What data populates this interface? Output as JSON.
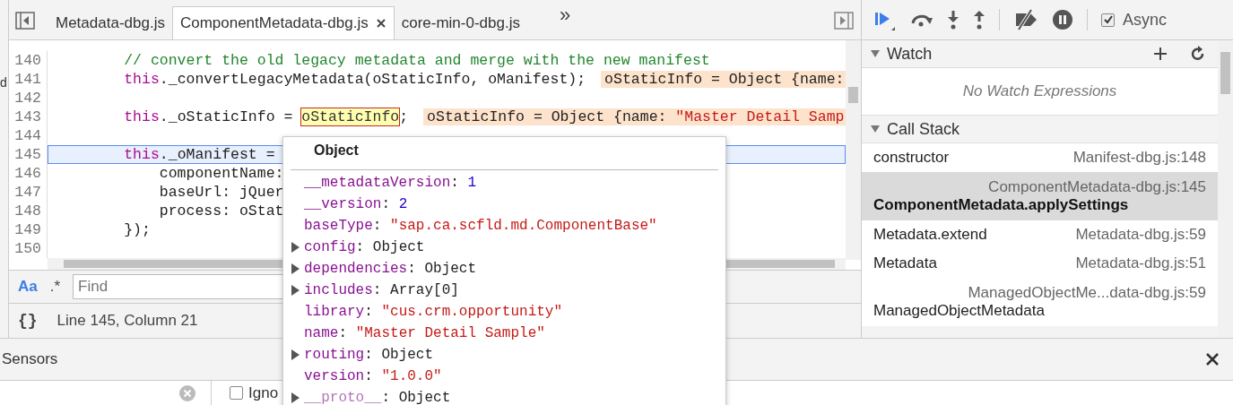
{
  "left_strip": {
    "text": "d"
  },
  "editor_tabs": [
    {
      "label": "Metadata-dbg.js",
      "selected": false
    },
    {
      "label": "ComponentMetadata-dbg.js",
      "selected": true
    },
    {
      "label": "core-min-0-dbg.js",
      "selected": false
    }
  ],
  "more_tabs": "»",
  "code": {
    "lines": [
      {
        "number": "140",
        "current": false,
        "segments": [
          {
            "kind": "comment",
            "text": "        // convert the old legacy metadata and merge with the new manifest"
          }
        ]
      },
      {
        "number": "141",
        "current": false,
        "segments": [
          {
            "kind": "keyword",
            "text": "        this"
          },
          {
            "kind": "plain",
            "text": "._convertLegacyMetadata(oStaticInfo, oManifest);"
          }
        ],
        "inline_value": [
          {
            "kind": "plain",
            "text": "oStaticInfo = Object {name:"
          }
        ]
      },
      {
        "number": "142",
        "current": false
      },
      {
        "number": "143",
        "current": false,
        "segments": [
          {
            "kind": "keyword",
            "text": "        this"
          },
          {
            "kind": "plain",
            "text": "._oStaticInfo = "
          },
          {
            "kind": "hover",
            "text": "oStaticInfo"
          },
          {
            "kind": "plain",
            "text": ";"
          }
        ],
        "inline_value": [
          {
            "kind": "plain",
            "text": "oStaticInfo = Object {name: "
          },
          {
            "kind": "string",
            "text": "\"Master Detail Samp"
          }
        ]
      },
      {
        "number": "144",
        "current": false
      },
      {
        "number": "145",
        "current": true,
        "segments": [
          {
            "kind": "keyword",
            "text": "        this"
          },
          {
            "kind": "plain",
            "text": "._oManifest ="
          }
        ]
      },
      {
        "number": "146",
        "current": false,
        "segments": [
          {
            "kind": "plain",
            "text": "            componentName:"
          }
        ]
      },
      {
        "number": "147",
        "current": false,
        "segments": [
          {
            "kind": "plain",
            "text": "            baseUrl: jQuer"
          }
        ]
      },
      {
        "number": "148",
        "current": false,
        "segments": [
          {
            "kind": "plain",
            "text": "            process: oStat"
          }
        ]
      },
      {
        "number": "149",
        "current": false,
        "segments": [
          {
            "kind": "plain",
            "text": "        });"
          }
        ]
      },
      {
        "number": "150",
        "current": false
      }
    ]
  },
  "popover": {
    "title": "Object",
    "properties": [
      {
        "name": "__metadataVersion",
        "separator": ":",
        "value": "1",
        "kind": "number",
        "expandable": false,
        "internal": false
      },
      {
        "name": "__version",
        "separator": ":",
        "value": "2",
        "kind": "number",
        "expandable": false,
        "internal": false
      },
      {
        "name": "baseType",
        "separator": ":",
        "value": "\"sap.ca.scfld.md.ComponentBase\"",
        "kind": "string",
        "expandable": false,
        "internal": false
      },
      {
        "name": "config",
        "separator": ":",
        "value": "Object",
        "kind": "object",
        "expandable": true,
        "internal": false
      },
      {
        "name": "dependencies",
        "separator": ":",
        "value": "Object",
        "kind": "object",
        "expandable": true,
        "internal": false
      },
      {
        "name": "includes",
        "separator": ":",
        "value": "Array[0]",
        "kind": "object",
        "expandable": true,
        "internal": false
      },
      {
        "name": "library",
        "separator": ":",
        "value": "\"cus.crm.opportunity\"",
        "kind": "string",
        "expandable": false,
        "internal": false
      },
      {
        "name": "name",
        "separator": ":",
        "value": "\"Master Detail Sample\"",
        "kind": "string",
        "expandable": false,
        "internal": false
      },
      {
        "name": "routing",
        "separator": ":",
        "value": "Object",
        "kind": "object",
        "expandable": true,
        "internal": false
      },
      {
        "name": "version",
        "separator": ":",
        "value": "\"1.0.0\"",
        "kind": "string",
        "expandable": false,
        "internal": false
      },
      {
        "name": "__proto__",
        "separator": ":",
        "value": "Object",
        "kind": "object",
        "expandable": true,
        "internal": true
      }
    ]
  },
  "find_bar": {
    "toggles": [
      {
        "label": "Aa",
        "selected": true
      },
      {
        "label": ".*",
        "selected": false
      }
    ],
    "placeholder": "Find"
  },
  "status_bar": {
    "format_button": "{}",
    "position": "Line 145, Column 21"
  },
  "debugger": {
    "async": {
      "label": "Async",
      "checked": true
    },
    "watch": {
      "title": "Watch",
      "expanded": true,
      "empty_text": "No Watch Expressions"
    },
    "call_stack": {
      "title": "Call Stack",
      "expanded": true,
      "frames": [
        {
          "name": "constructor",
          "location": "Manifest-dbg.js:148",
          "selected": false,
          "kind": "inline"
        },
        {
          "name": "ComponentMetadata.applySettings",
          "location": "ComponentMetadata-dbg.js:145",
          "selected": true,
          "kind": "stacked"
        },
        {
          "name": "Metadata.extend",
          "location": "Metadata-dbg.js:59",
          "selected": false,
          "kind": "inline"
        },
        {
          "name": "Metadata",
          "location": "Metadata-dbg.js:51",
          "selected": false,
          "kind": "inline"
        },
        {
          "name": "ManagedObjectMetadata",
          "location": "ManagedObjectMe...data-dbg.js:59",
          "selected": false,
          "kind": "stacked"
        }
      ]
    }
  },
  "drawer": {
    "tab": "Sensors",
    "filter_checkbox": {
      "label": "Igno",
      "checked": false
    }
  }
}
